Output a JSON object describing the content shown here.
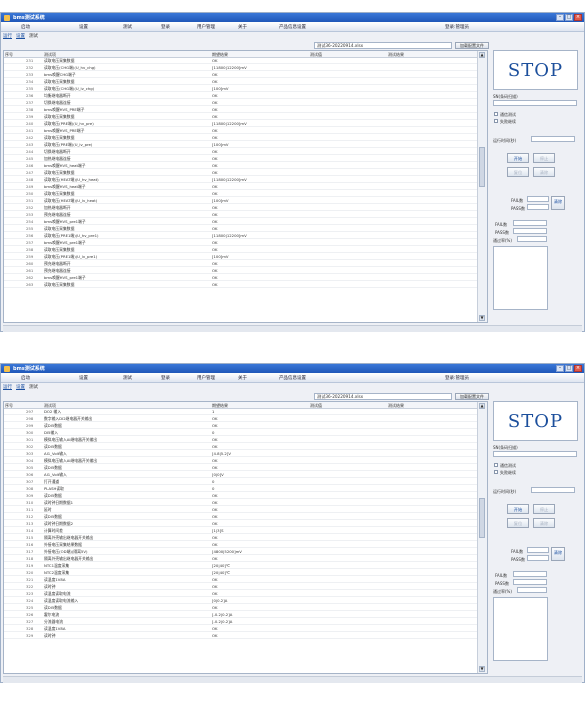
{
  "windows": [
    {
      "title": "bms测试系统",
      "menu": [
        "启动",
        "设置",
        "测试",
        "登录",
        "用户管理",
        "关于",
        "产品信息设置"
      ],
      "user": "登录:管理员",
      "tabs": [
        "运行",
        "设置",
        "测试"
      ],
      "file_name": "测试36-20220914.xlsx",
      "load_button": "加载配置文件",
      "columns": [
        "序号",
        "测试项",
        "期望结果",
        "测试值",
        "测试结果"
      ],
      "rows": [
        {
          "no": "231",
          "item": "读取电压采集数据",
          "result": "OK"
        },
        {
          "no": "232",
          "item": "读取电压(CHG端)(U_hv_chg)",
          "result": "[11800|12200]mV"
        },
        {
          "no": "233",
          "item": "bms唤醒CHG端子",
          "result": "OK"
        },
        {
          "no": "234",
          "item": "读取电压采集数据",
          "result": "OK"
        },
        {
          "no": "235",
          "item": "读取电压(CHG端)(U_lv_chg)",
          "result": "[100]mV"
        },
        {
          "no": "236",
          "item": "均衡继电器断开",
          "result": "OK"
        },
        {
          "no": "237",
          "item": "切换继电器连接",
          "result": "OK"
        },
        {
          "no": "238",
          "item": "bms唤醒HVS_PRE端子",
          "result": "OK"
        },
        {
          "no": "239",
          "item": "读取电压采集数据",
          "result": "OK"
        },
        {
          "no": "240",
          "item": "读取电压(PRE端)(U_hv_pre)",
          "result": "[11800|12200]mV"
        },
        {
          "no": "241",
          "item": "bms唤醒HVS_PRE端子",
          "result": "OK"
        },
        {
          "no": "242",
          "item": "读取电压采集数据",
          "result": "OK"
        },
        {
          "no": "243",
          "item": "读取电压(PRE端)(U_lv_pre)",
          "result": "[100]mV"
        },
        {
          "no": "244",
          "item": "切换继电器断开",
          "result": "OK"
        },
        {
          "no": "245",
          "item": "加热继电器连接",
          "result": "OK"
        },
        {
          "no": "246",
          "item": "bms唤醒HVS_heat端子",
          "result": "OK"
        },
        {
          "no": "247",
          "item": "读取电压采集数据",
          "result": "OK"
        },
        {
          "no": "248",
          "item": "读取电压(HEAT端)(U_hv_heat)",
          "result": "[11800|12200]mV"
        },
        {
          "no": "249",
          "item": "bms唤醒HVS_heat端子",
          "result": "OK"
        },
        {
          "no": "250",
          "item": "读取电压采集数据",
          "result": "OK"
        },
        {
          "no": "251",
          "item": "读取电压(HEAT端)(U_lv_heat)",
          "result": "[100]mV"
        },
        {
          "no": "252",
          "item": "加热继电器断开",
          "result": "OK"
        },
        {
          "no": "253",
          "item": "预充继电器连接",
          "result": "OK"
        },
        {
          "no": "254",
          "item": "bms唤醒HVS_pre1端子",
          "result": "OK"
        },
        {
          "no": "255",
          "item": "读取电压采集数据",
          "result": "OK"
        },
        {
          "no": "256",
          "item": "读取电压(PRE1端)(U_hv_pre1)",
          "result": "[11800|12200]mV"
        },
        {
          "no": "257",
          "item": "bms唤醒HVS_pre1端子",
          "result": "OK"
        },
        {
          "no": "258",
          "item": "读取电压采集数据",
          "result": "OK"
        },
        {
          "no": "259",
          "item": "读取电压(PRE1端)(U_lv_pre1)",
          "result": "[100]mV"
        },
        {
          "no": "260",
          "item": "预充继电器断开",
          "result": "OK"
        },
        {
          "no": "261",
          "item": "预充继电器连接",
          "result": "OK"
        },
        {
          "no": "262",
          "item": "bms唤醒HVS_pre1端子",
          "result": "OK"
        },
        {
          "no": "263",
          "item": "读取电压采集数据",
          "result": "OK"
        }
      ],
      "side": {
        "stop": "STOP",
        "sn_label": "SN(条码扫描)",
        "check1": "通信测试",
        "check2": "失败继续",
        "time_label": "运行时间(秒)",
        "btn_start": "开始",
        "btn_stop": "停止",
        "btn_reset": "复位",
        "btn_clear": "清除",
        "fail_label": "FAIL数",
        "pass_label": "PASS数",
        "clear_btn": "清除",
        "fail_count_label": "FAIL数",
        "pass_count_label": "PASS数",
        "rate_label": "通过率(%)"
      }
    },
    {
      "title": "bms测试系统",
      "menu": [
        "启动",
        "设置",
        "测试",
        "登录",
        "用户管理",
        "关于",
        "产品信息设置"
      ],
      "user": "登录:管理员",
      "tabs": [
        "运行",
        "设置",
        "测试"
      ],
      "file_name": "测试36-20220914.xlsx",
      "load_button": "加载配置文件",
      "columns": [
        "序号",
        "测试项",
        "期望结果",
        "测试值",
        "测试结果"
      ],
      "rows": [
        {
          "no": "297",
          "item": "DO2 输入",
          "result": "1"
        },
        {
          "no": "298",
          "item": "数字输入DI2继电器开关输出",
          "result": "OK"
        },
        {
          "no": "299",
          "item": "读DI5数据",
          "result": "OK"
        },
        {
          "no": "300",
          "item": "DI5输入",
          "result": "0"
        },
        {
          "no": "301",
          "item": "模拟电压输入AI继电器开关输出",
          "result": "OK"
        },
        {
          "no": "302",
          "item": "读DI5数据",
          "result": "OK"
        },
        {
          "no": "303",
          "item": "AI1_Volt输入",
          "result": "[4.8|5.2]V"
        },
        {
          "no": "304",
          "item": "模拟电压输入AI继电器开关输出",
          "result": "OK"
        },
        {
          "no": "305",
          "item": "读DI5数据",
          "result": "OK"
        },
        {
          "no": "306",
          "item": "AI1_Volt输入",
          "result": "[0|0]V"
        },
        {
          "no": "307",
          "item": "打开通道",
          "result": "0"
        },
        {
          "no": "308",
          "item": "PLASH读取",
          "result": "0"
        },
        {
          "no": "309",
          "item": "读DI5数据",
          "result": "OK"
        },
        {
          "no": "310",
          "item": "读时钟日期数据1",
          "result": "OK"
        },
        {
          "no": "311",
          "item": "延时",
          "result": "OK"
        },
        {
          "no": "312",
          "item": "读DI5数据",
          "result": "OK"
        },
        {
          "no": "313",
          "item": "读时钟日期数据2",
          "result": "OK"
        },
        {
          "no": "314",
          "item": "计算时间差",
          "result": "[1|3]S"
        },
        {
          "no": "315",
          "item": "隔离外壳输出继电器开关输出",
          "result": "OK"
        },
        {
          "no": "316",
          "item": "外接电压采集结果数据",
          "result": "OK"
        },
        {
          "no": "317",
          "item": "外接电压(OD端)(隔离5V)",
          "result": "[4800|5200]mV"
        },
        {
          "no": "318",
          "item": "隔离外壳输出继电器开关输出",
          "result": "OK"
        },
        {
          "no": "319",
          "item": "NTC1温度采集",
          "result": "[20|40]℃"
        },
        {
          "no": "320",
          "item": "NTC2温度采集",
          "result": "[20|40]℃"
        },
        {
          "no": "321",
          "item": "读温度1V8A",
          "result": "OK"
        },
        {
          "no": "322",
          "item": "读时钟",
          "result": "OK"
        },
        {
          "no": "323",
          "item": "读温度读取电流",
          "result": "OK"
        },
        {
          "no": "324",
          "item": "读温度读取电流输入",
          "result": "[0|0.2]A"
        },
        {
          "no": "325",
          "item": "读DI5数据",
          "result": "OK"
        },
        {
          "no": "326",
          "item": "霍尔电流",
          "result": "[-0.2|0.2]A"
        },
        {
          "no": "327",
          "item": "分流器电流",
          "result": "[-0.2|0.2]A"
        },
        {
          "no": "328",
          "item": "读温度1V8A",
          "result": "OK"
        },
        {
          "no": "329",
          "item": "读时钟",
          "result": "OK"
        }
      ],
      "side": {
        "stop": "STOP",
        "sn_label": "SN(条码扫描)",
        "check1": "通信测试",
        "check2": "失败继续",
        "time_label": "运行时间(秒)",
        "btn_start": "开始",
        "btn_stop": "停止",
        "btn_reset": "复位",
        "btn_clear": "清除",
        "fail_label": "FAIL数",
        "pass_label": "PASS数",
        "clear_btn": "清除",
        "fail_count_label": "FAIL数",
        "pass_count_label": "PASS数",
        "rate_label": "通过率(%)"
      }
    }
  ],
  "colors": {
    "titlebar": "#2a66c8",
    "stop_text": "#1c4f9c",
    "link": "#1a4fa0"
  },
  "icons": [
    "app-icon",
    "minimize-icon",
    "maximize-icon",
    "close-icon",
    "scroll-up-icon",
    "scroll-down-icon"
  ]
}
